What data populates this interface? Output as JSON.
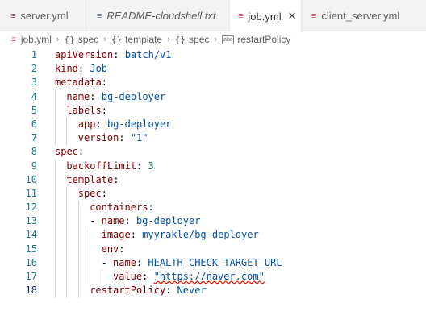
{
  "tabs": [
    {
      "label": "server.yml",
      "icon": "yml-file-icon",
      "active": false,
      "italic": false
    },
    {
      "label": "README-cloudshell.txt",
      "icon": "text-file-icon",
      "active": false,
      "italic": true
    },
    {
      "label": "job.yml",
      "icon": "yml-file-icon",
      "active": true,
      "italic": false
    },
    {
      "label": "client_server.yml",
      "icon": "yml-file-icon",
      "active": false,
      "italic": false
    }
  ],
  "breadcrumb": {
    "file": "job.yml",
    "items": [
      "spec",
      "template",
      "spec"
    ],
    "last": "restartPolicy"
  },
  "editor": {
    "current_line": 18,
    "lines": [
      {
        "n": "1",
        "indent": 0,
        "tokens": [
          {
            "t": "apiVersion",
            "c": "key"
          },
          {
            "t": ": ",
            "c": "plain"
          },
          {
            "t": "batch/v1",
            "c": "str"
          }
        ]
      },
      {
        "n": "2",
        "indent": 0,
        "tokens": [
          {
            "t": "kind",
            "c": "key"
          },
          {
            "t": ": ",
            "c": "plain"
          },
          {
            "t": "Job",
            "c": "str"
          }
        ]
      },
      {
        "n": "3",
        "indent": 0,
        "tokens": [
          {
            "t": "metadata",
            "c": "key"
          },
          {
            "t": ":",
            "c": "plain"
          }
        ]
      },
      {
        "n": "4",
        "indent": 1,
        "tokens": [
          {
            "t": "name",
            "c": "key"
          },
          {
            "t": ": ",
            "c": "plain"
          },
          {
            "t": "bg-deployer",
            "c": "str"
          }
        ]
      },
      {
        "n": "5",
        "indent": 1,
        "tokens": [
          {
            "t": "labels",
            "c": "key"
          },
          {
            "t": ":",
            "c": "plain"
          }
        ]
      },
      {
        "n": "6",
        "indent": 2,
        "tokens": [
          {
            "t": "app",
            "c": "key"
          },
          {
            "t": ": ",
            "c": "plain"
          },
          {
            "t": "bg-deployer",
            "c": "str"
          }
        ]
      },
      {
        "n": "7",
        "indent": 2,
        "tokens": [
          {
            "t": "version",
            "c": "key"
          },
          {
            "t": ": ",
            "c": "plain"
          },
          {
            "t": "\"1\"",
            "c": "str"
          }
        ]
      },
      {
        "n": "8",
        "indent": 0,
        "tokens": [
          {
            "t": "spec",
            "c": "key"
          },
          {
            "t": ":",
            "c": "plain"
          }
        ]
      },
      {
        "n": "9",
        "indent": 1,
        "tokens": [
          {
            "t": "backoffLimit",
            "c": "key"
          },
          {
            "t": ": ",
            "c": "plain"
          },
          {
            "t": "3",
            "c": "num"
          }
        ]
      },
      {
        "n": "10",
        "indent": 1,
        "tokens": [
          {
            "t": "template",
            "c": "key"
          },
          {
            "t": ":",
            "c": "plain"
          }
        ]
      },
      {
        "n": "11",
        "indent": 2,
        "tokens": [
          {
            "t": "spec",
            "c": "key"
          },
          {
            "t": ":",
            "c": "plain"
          }
        ]
      },
      {
        "n": "12",
        "indent": 3,
        "tokens": [
          {
            "t": "containers",
            "c": "key"
          },
          {
            "t": ":",
            "c": "plain"
          }
        ]
      },
      {
        "n": "13",
        "indent": 3,
        "tokens": [
          {
            "t": "- ",
            "c": "plain"
          },
          {
            "t": "name",
            "c": "key"
          },
          {
            "t": ": ",
            "c": "plain"
          },
          {
            "t": "bg-deployer",
            "c": "str"
          }
        ]
      },
      {
        "n": "14",
        "indent": 4,
        "tokens": [
          {
            "t": "image",
            "c": "key"
          },
          {
            "t": ": ",
            "c": "plain"
          },
          {
            "t": "myyrakle/bg-deployer",
            "c": "str"
          }
        ]
      },
      {
        "n": "15",
        "indent": 4,
        "tokens": [
          {
            "t": "env",
            "c": "key"
          },
          {
            "t": ":",
            "c": "plain"
          }
        ]
      },
      {
        "n": "16",
        "indent": 4,
        "tokens": [
          {
            "t": "- ",
            "c": "plain"
          },
          {
            "t": "name",
            "c": "key"
          },
          {
            "t": ": ",
            "c": "plain"
          },
          {
            "t": "HEALTH_CHECK_TARGET_URL",
            "c": "str"
          }
        ]
      },
      {
        "n": "17",
        "indent": 5,
        "tokens": [
          {
            "t": "value",
            "c": "key"
          },
          {
            "t": ": ",
            "c": "plain"
          },
          {
            "t": "\"https://naver.com\"",
            "c": "str squiggle"
          }
        ]
      },
      {
        "n": "18",
        "indent": 3,
        "tokens": [
          {
            "t": "restartPolicy",
            "c": "key"
          },
          {
            "t": ": ",
            "c": "plain"
          },
          {
            "t": "Never",
            "c": "str"
          }
        ]
      }
    ]
  },
  "colors": {
    "key": "#800000",
    "string": "#0451a5",
    "number": "#098658",
    "line_number": "#237893",
    "error_squiggle": "#e51400"
  }
}
